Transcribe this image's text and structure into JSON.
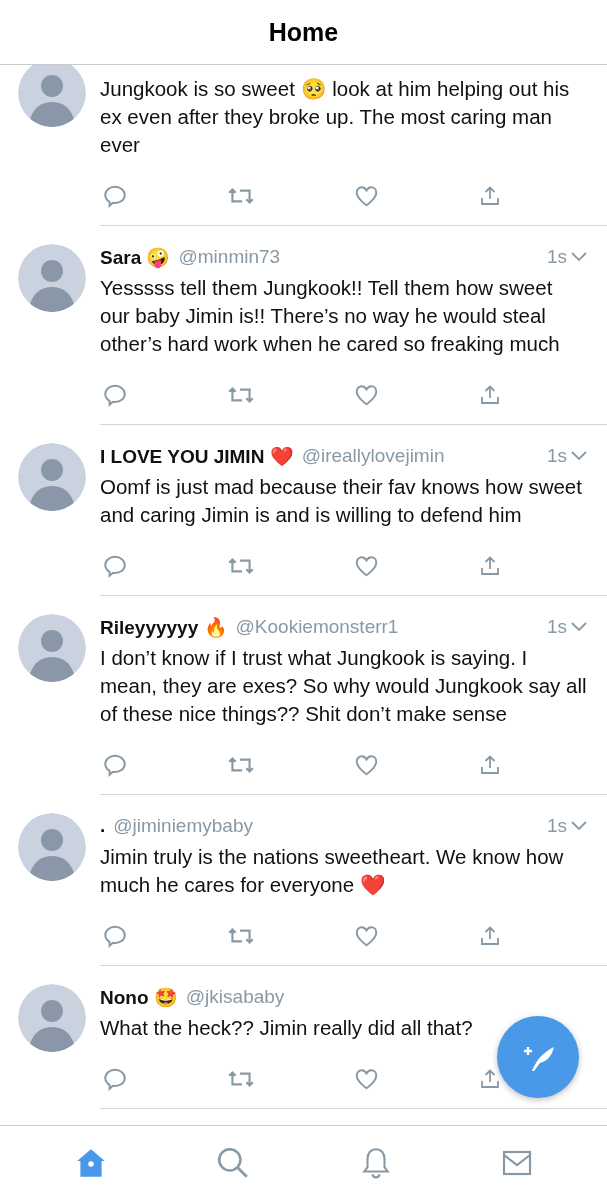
{
  "header": {
    "title": "Home"
  },
  "tweets": [
    {
      "body": "Jungkook is so sweet 🥺 look at him helping out his ex even after they broke up. The most caring man ever"
    },
    {
      "name": "Sara 🤪",
      "handle": "@minmin73",
      "time": "1s",
      "body": "Yesssss tell them Jungkook!! Tell them how sweet our baby Jimin is!! There’s no way he would steal other’s hard work when he cared so freaking much"
    },
    {
      "name": "I LOVE YOU JIMIN ❤️",
      "handle": "@ireallylovejimin",
      "time": "1s",
      "body": "Oomf is just mad because their fav knows how sweet and caring Jimin is and is willing to defend him"
    },
    {
      "name": "Rileyyyyyy 🔥",
      "handle": "@Kookiemonsterr1",
      "time": "1s",
      "body": "I don’t know if I trust what Jungkook is saying. I mean, they are exes? So why would Jungkook say all of these nice things?? Shit don’t make sense"
    },
    {
      "name": ".",
      "handle": "@jiminiemybaby",
      "time": "1s",
      "body": "Jimin truly is the nations sweetheart. We know how much he cares for everyone ❤️"
    },
    {
      "name": "Nono 🤩",
      "handle": "@jkisababy",
      "body": "What the heck?? Jimin really did all that?"
    }
  ],
  "tabs": [
    {
      "kind": "home",
      "selected": true
    },
    {
      "kind": "search",
      "selected": false
    },
    {
      "kind": "notifications",
      "selected": false
    },
    {
      "kind": "messages",
      "selected": false
    }
  ]
}
